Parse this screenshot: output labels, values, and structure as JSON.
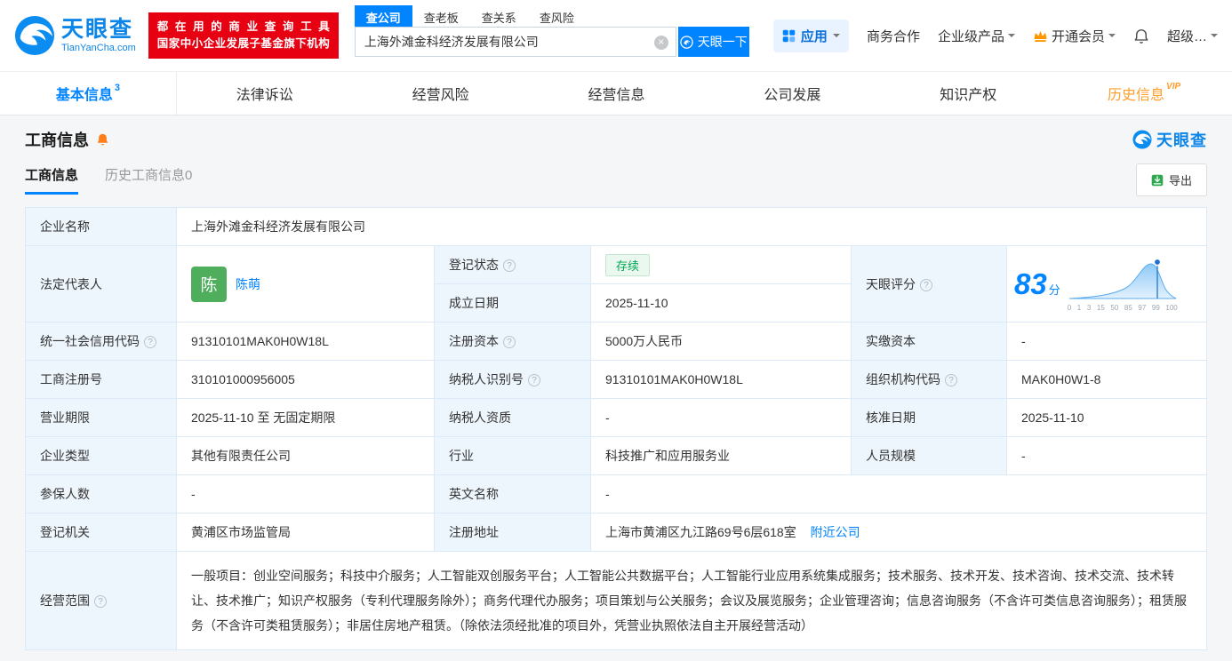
{
  "colors": {
    "brand_blue": "#0084ff",
    "promo_red": "#e60012",
    "member_orange": "#ff8a00",
    "status_green": "#00a854",
    "history_tab_orange": "#ff9d2b"
  },
  "topbar": {
    "logo": {
      "title": "天眼查",
      "subtitle": "TianYanCha.com"
    },
    "promo": {
      "line1": "都在用的商业查询工具",
      "line2": "国家中小企业发展子基金旗下机构"
    },
    "search": {
      "tabs": [
        {
          "label": "查公司",
          "active": true
        },
        {
          "label": "查老板",
          "active": false
        },
        {
          "label": "查关系",
          "active": false
        },
        {
          "label": "查风险",
          "active": false
        }
      ],
      "value": "上海外滩金科经济发展有限公司",
      "button": "天眼一下"
    },
    "nav": {
      "apps": "应用",
      "cooperation": "商务合作",
      "enterprise": "企业级产品",
      "membership": "开通会员",
      "super": "超级…"
    }
  },
  "main_tabs": [
    {
      "label": "基本信息",
      "badge": "3",
      "active": true
    },
    {
      "label": "法律诉讼"
    },
    {
      "label": "经营风险"
    },
    {
      "label": "经营信息"
    },
    {
      "label": "公司发展"
    },
    {
      "label": "知识产权"
    },
    {
      "label": "历史信息",
      "badge": "VIP"
    }
  ],
  "section": {
    "title": "工商信息",
    "brand": "天眼查",
    "tabs": [
      {
        "label": "工商信息",
        "active": true
      },
      {
        "label": "历史工商信息0",
        "active": false
      }
    ],
    "export_label": "导出"
  },
  "info": {
    "company_name": {
      "label": "企业名称",
      "value": "上海外滩金科经济发展有限公司"
    },
    "legal_rep": {
      "label": "法定代表人",
      "avatar": "陈",
      "name": "陈萌"
    },
    "reg_status": {
      "label": "登记状态",
      "value": "存续"
    },
    "establish_date": {
      "label": "成立日期",
      "value": "2025-11-10"
    },
    "score": {
      "label": "天眼评分",
      "value": "83",
      "unit": "分",
      "axis": [
        "0",
        "1",
        "3",
        "15",
        "50",
        "85",
        "97",
        "99",
        "100"
      ]
    },
    "credit_code": {
      "label": "统一社会信用代码",
      "value": "91310101MAK0H0W18L"
    },
    "reg_capital": {
      "label": "注册资本",
      "value": "5000万人民币"
    },
    "paid_capital": {
      "label": "实缴资本",
      "value": "-"
    },
    "reg_number": {
      "label": "工商注册号",
      "value": "310101000956005"
    },
    "taxpayer_id": {
      "label": "纳税人识别号",
      "value": "91310101MAK0H0W18L"
    },
    "org_code": {
      "label": "组织机构代码",
      "value": "MAK0H0W1-8"
    },
    "business_term": {
      "label": "营业期限",
      "value": "2025-11-10 至 无固定期限"
    },
    "taxpayer_quality": {
      "label": "纳税人资质",
      "value": "-"
    },
    "approval_date": {
      "label": "核准日期",
      "value": "2025-11-10"
    },
    "company_type": {
      "label": "企业类型",
      "value": "其他有限责任公司"
    },
    "industry": {
      "label": "行业",
      "value": "科技推广和应用服务业"
    },
    "staff_size": {
      "label": "人员规模",
      "value": "-"
    },
    "insured_count": {
      "label": "参保人数",
      "value": "-"
    },
    "english_name": {
      "label": "英文名称",
      "value": "-"
    },
    "reg_authority": {
      "label": "登记机关",
      "value": "黄浦区市场监管局"
    },
    "reg_address": {
      "label": "注册地址",
      "value": "上海市黄浦区九江路69号6层618室",
      "link": "附近公司"
    },
    "business_scope": {
      "label": "经营范围",
      "value": "一般项目：创业空间服务；科技中介服务；人工智能双创服务平台；人工智能公共数据平台；人工智能行业应用系统集成服务；技术服务、技术开发、技术咨询、技术交流、技术转让、技术推广；知识产权服务（专利代理服务除外）；商务代理代办服务；项目策划与公关服务；会议及展览服务；企业管理咨询；信息咨询服务（不含许可类信息咨询服务）；租赁服务（不含许可类租赁服务）；非居住房地产租赁。（除依法须经批准的项目外，凭营业执照依法自主开展经营活动）"
    }
  }
}
